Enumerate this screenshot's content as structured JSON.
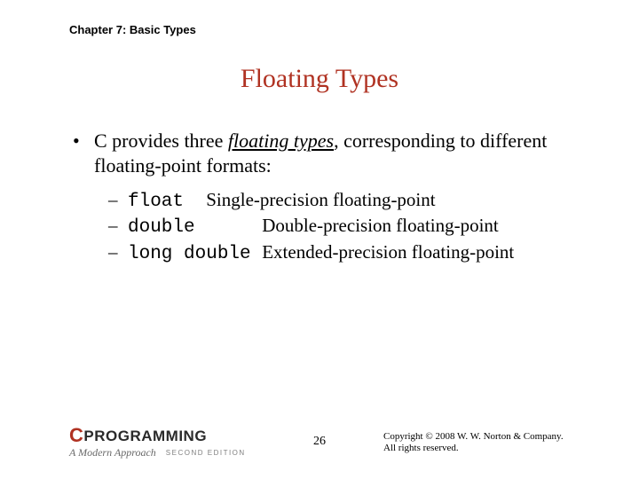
{
  "chapter_header": "Chapter 7: Basic Types",
  "title": "Floating Types",
  "bullet": {
    "pre": "C provides three ",
    "emph": "floating types",
    "post": ", corresponding to different floating-point formats:"
  },
  "types": [
    {
      "keyword": "float",
      "pad": "  ",
      "desc": "Single-precision floating-point"
    },
    {
      "keyword": "double",
      "pad": "      ",
      "desc": "Double-precision floating-point"
    },
    {
      "keyword": "long double",
      "pad": " ",
      "desc": "Extended-precision floating-point"
    }
  ],
  "page_number": "26",
  "copyright": {
    "line1": "Copyright © 2008 W. W. Norton & Company.",
    "line2": "All rights reserved."
  },
  "branding": {
    "c": "C",
    "rest": "PROGRAMMING",
    "subtitle": "A Modern Approach",
    "edition": "SECOND EDITION"
  }
}
